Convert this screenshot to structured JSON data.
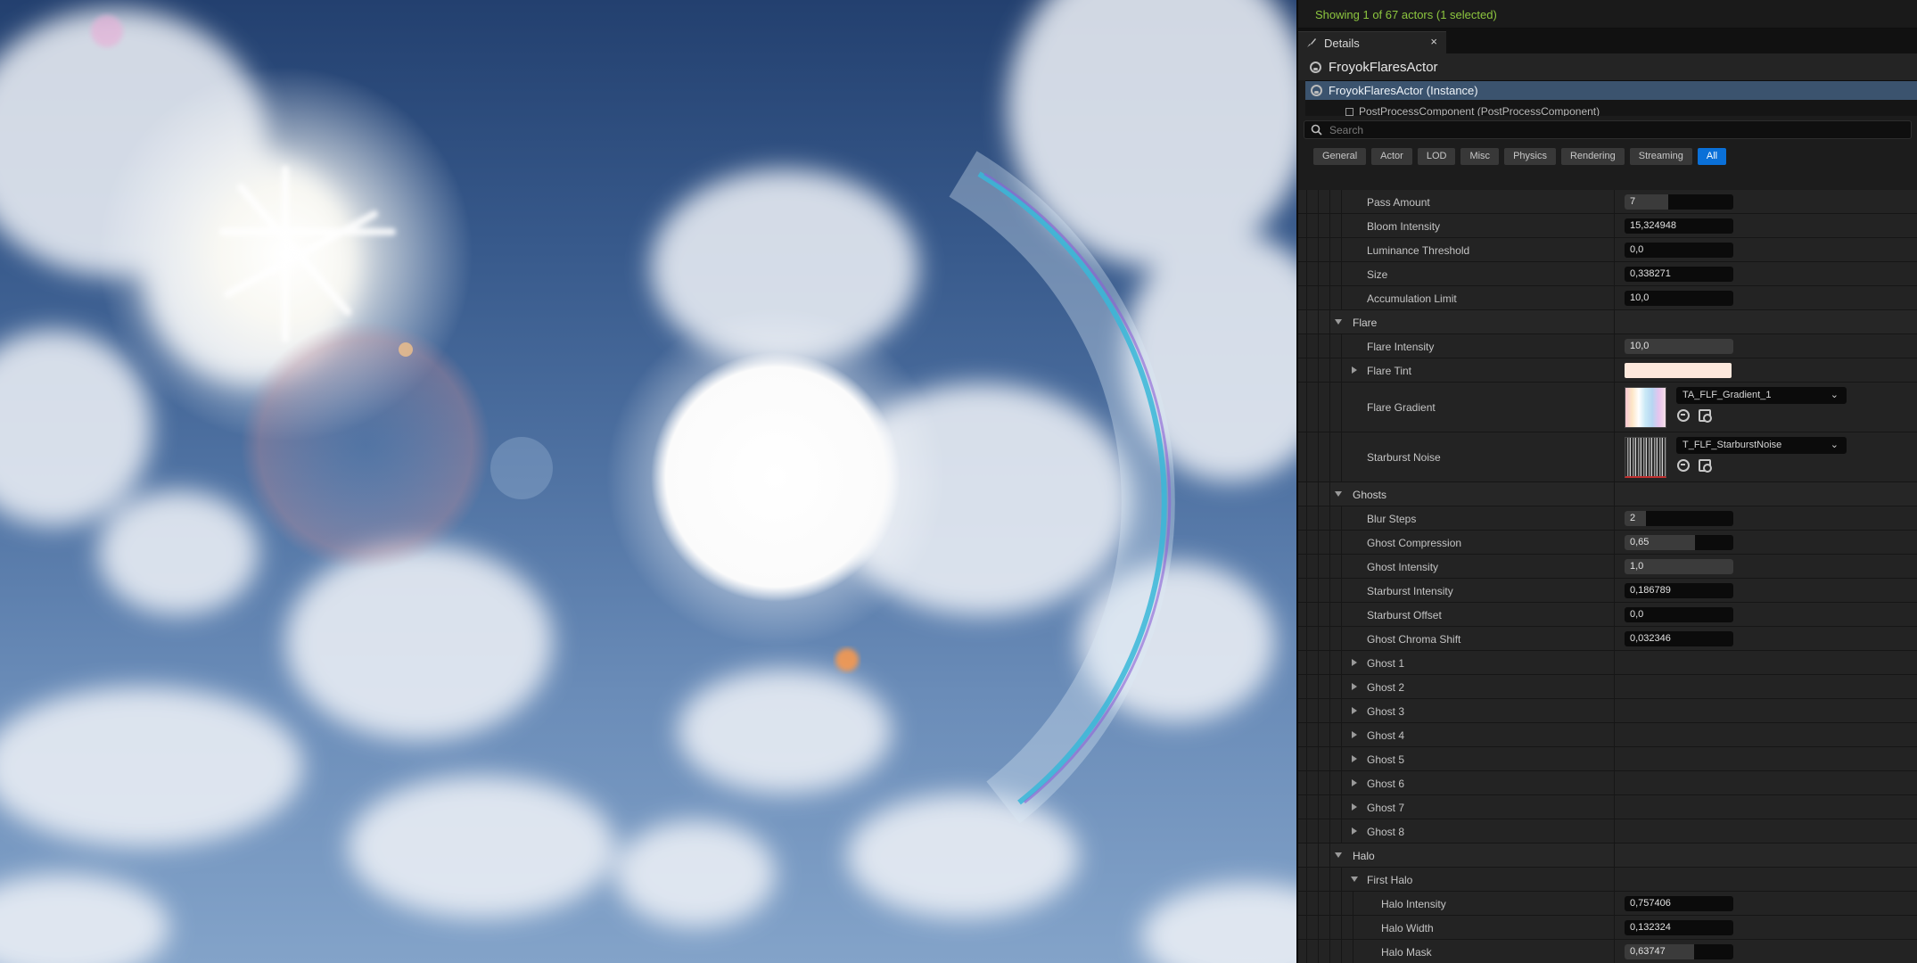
{
  "status": {
    "actors_text": "Showing 1 of 67 actors (1 selected)"
  },
  "details_tab": {
    "label": "Details",
    "close": "×"
  },
  "actor": {
    "name": "FroyokFlaresActor"
  },
  "component_tree": {
    "selected": "FroyokFlaresActor (Instance)",
    "child": "PostProcessComponent (PostProcessComponent)"
  },
  "search": {
    "placeholder": "Search"
  },
  "filters": [
    "General",
    "Actor",
    "LOD",
    "Misc",
    "Physics",
    "Rendering",
    "Streaming",
    "All"
  ],
  "properties": {
    "pass_amount": {
      "label": "Pass Amount",
      "value": "7",
      "fill": 0.4
    },
    "bloom_intensity": {
      "label": "Bloom Intensity",
      "value": "15,324948"
    },
    "luminance_threshold": {
      "label": "Luminance Threshold",
      "value": "0,0"
    },
    "size": {
      "label": "Size",
      "value": "0,338271"
    },
    "accumulation_limit": {
      "label": "Accumulation Limit",
      "value": "10,0"
    },
    "flare": {
      "label": "Flare",
      "intensity": {
        "label": "Flare Intensity",
        "value": "10,0",
        "fill": 1.0
      },
      "tint": {
        "label": "Flare Tint",
        "color": "#fde8dc"
      },
      "gradient": {
        "label": "Flare Gradient",
        "asset": "TA_FLF_Gradient_1"
      },
      "starburst": {
        "label": "Starburst Noise",
        "asset": "T_FLF_StarburstNoise"
      }
    },
    "ghosts": {
      "label": "Ghosts",
      "blur_steps": {
        "label": "Blur Steps",
        "value": "2",
        "fill": 0.2
      },
      "ghost_compression": {
        "label": "Ghost Compression",
        "value": "0,65",
        "fill": 0.65
      },
      "ghost_intensity": {
        "label": "Ghost Intensity",
        "value": "1,0",
        "fill": 1.0
      },
      "starburst_intensity": {
        "label": "Starburst Intensity",
        "value": "0,186789"
      },
      "starburst_offset": {
        "label": "Starburst Offset",
        "value": "0,0"
      },
      "ghost_chroma_shift": {
        "label": "Ghost Chroma Shift",
        "value": "0,032346"
      },
      "items": [
        "Ghost 1",
        "Ghost 2",
        "Ghost 3",
        "Ghost 4",
        "Ghost 5",
        "Ghost 6",
        "Ghost 7",
        "Ghost 8"
      ]
    },
    "halo": {
      "label": "Halo",
      "first_halo": {
        "label": "First Halo"
      },
      "halo_intensity": {
        "label": "Halo Intensity",
        "value": "0,757406"
      },
      "halo_width": {
        "label": "Halo Width",
        "value": "0,132324"
      },
      "halo_mask": {
        "label": "Halo Mask",
        "value": "0,63747",
        "fill": 0.64
      }
    }
  },
  "colors": {
    "status_green": "#8dc63f",
    "selection_blue": "#3b536e",
    "accent_blue": "#0a70d8"
  }
}
